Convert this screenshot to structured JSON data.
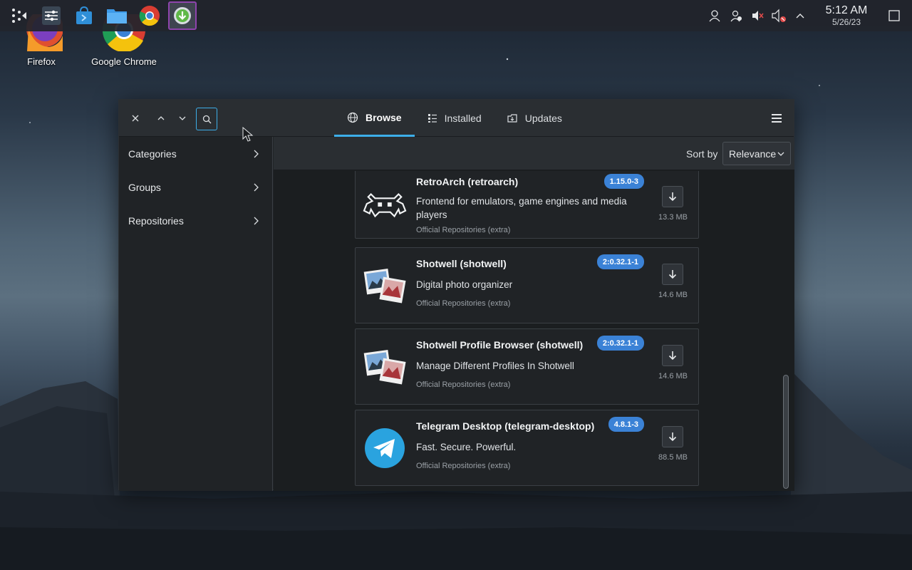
{
  "colors": {
    "accent": "#3daee9",
    "badge": "#3b82d6",
    "window_bg": "#202326",
    "header_bg": "#2a2e32"
  },
  "taskbar": {
    "apps": [
      {
        "name": "app-launcher",
        "icon": "launcher-icon"
      },
      {
        "name": "system-settings",
        "icon": "settings-sliders-icon"
      },
      {
        "name": "discover-store",
        "icon": "store-bag-icon"
      },
      {
        "name": "file-manager",
        "icon": "folder-icon"
      },
      {
        "name": "google-chrome",
        "icon": "chrome-icon"
      },
      {
        "name": "package-manager",
        "icon": "download-arrow-icon",
        "active": true
      }
    ],
    "tray": [
      "user-icon",
      "user-switch-icon",
      "speaker-muted-icon",
      "volume-muted-icon",
      "chevron-up-icon"
    ],
    "clock": {
      "time": "5:12 AM",
      "date": "5/26/23"
    }
  },
  "desktop": {
    "icons": [
      {
        "label": "Firefox"
      },
      {
        "label": "Google Chrome"
      }
    ]
  },
  "window": {
    "tabs": [
      {
        "label": "Browse",
        "icon": "globe-icon",
        "selected": true
      },
      {
        "label": "Installed",
        "icon": "list-icon",
        "selected": false
      },
      {
        "label": "Updates",
        "icon": "update-box-icon",
        "selected": false
      }
    ],
    "sidebar": {
      "items": [
        {
          "label": "Categories"
        },
        {
          "label": "Groups"
        },
        {
          "label": "Repositories"
        }
      ]
    },
    "sort": {
      "label": "Sort by",
      "value": "Relevance"
    },
    "packages": [
      {
        "name": "RetroArch (retroarch)",
        "version": "1.15.0-3",
        "description": "Frontend for emulators, game engines and media players",
        "repository": "Official Repositories (extra)",
        "size": "13.3 MB",
        "icon": "retroarch-icon"
      },
      {
        "name": "Shotwell (shotwell)",
        "version": "2:0.32.1-1",
        "description": "Digital photo organizer",
        "repository": "Official Repositories (extra)",
        "size": "14.6 MB",
        "icon": "shotwell-icon"
      },
      {
        "name": "Shotwell Profile Browser (shotwell)",
        "version": "2:0.32.1-1",
        "description": "Manage Different Profiles In Shotwell",
        "repository": "Official Repositories (extra)",
        "size": "14.6 MB",
        "icon": "shotwell-icon"
      },
      {
        "name": "Telegram Desktop (telegram-desktop)",
        "version": "4.8.1-3",
        "description": "Fast. Secure. Powerful.",
        "repository": "Official Repositories (extra)",
        "size": "88.5 MB",
        "icon": "telegram-icon"
      }
    ]
  }
}
